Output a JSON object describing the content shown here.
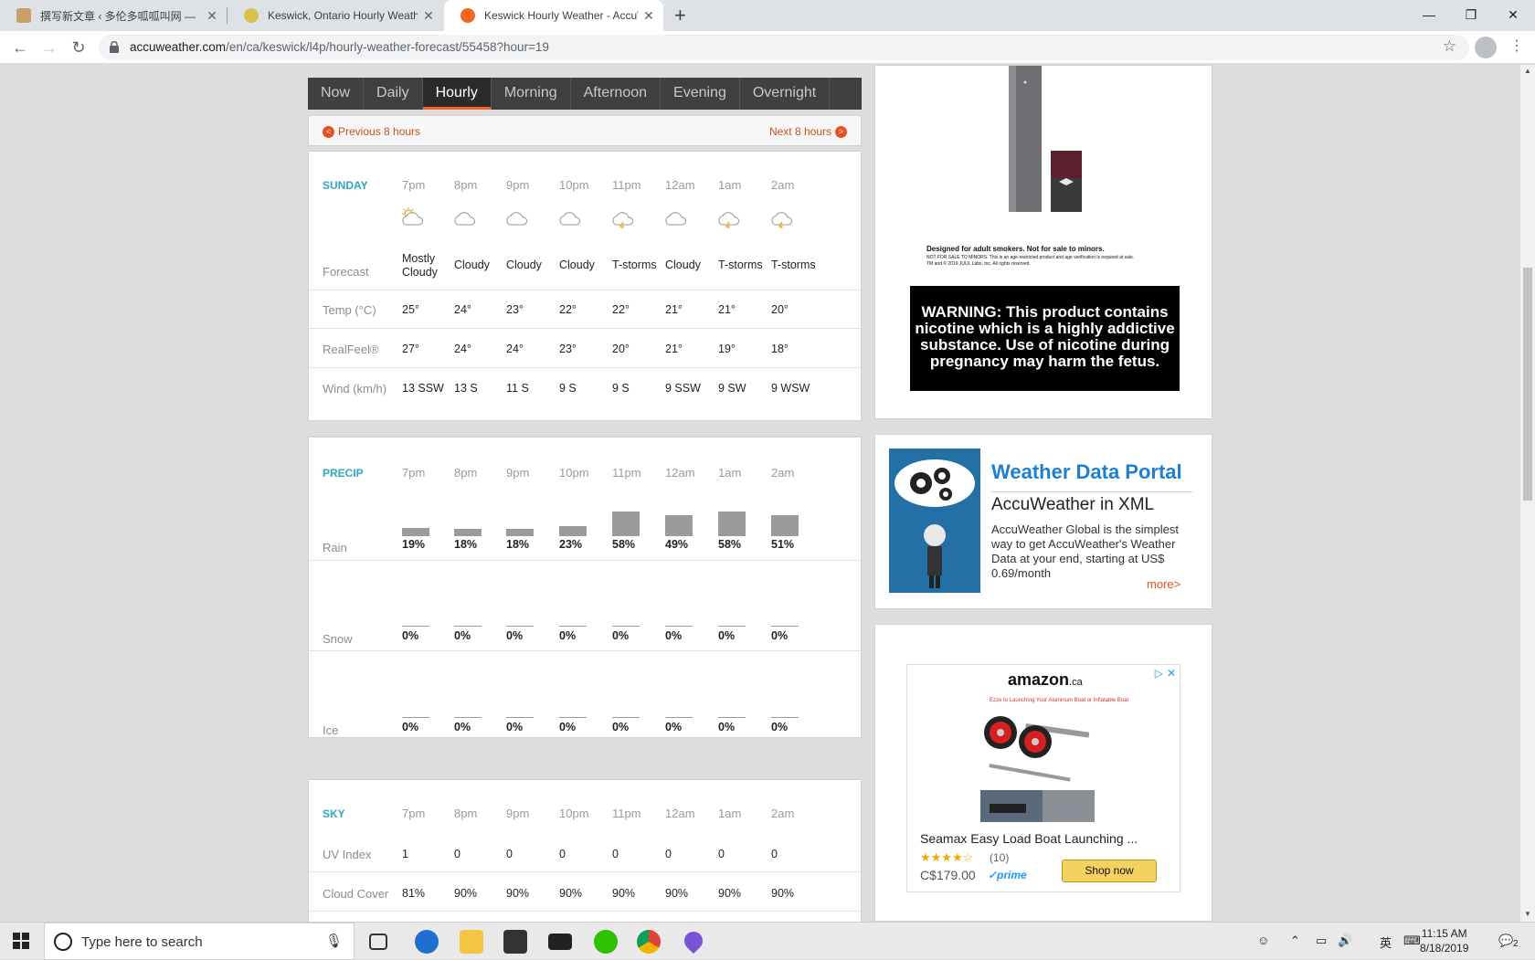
{
  "browser": {
    "tabs": [
      {
        "title": "撰写新文章 ‹ 多伦多呱呱叫网 —",
        "active": false
      },
      {
        "title": "Keswick, Ontario Hourly Weather",
        "active": false
      },
      {
        "title": "Keswick Hourly Weather - AccuW",
        "active": true
      }
    ],
    "url_host": "accuweather.com",
    "url_path": "/en/ca/keswick/l4p/hourly-weather-forecast/55458?hour=19"
  },
  "nav": {
    "tabs": [
      "Now",
      "Daily",
      "Hourly",
      "Morning",
      "Afternoon",
      "Evening",
      "Overnight"
    ],
    "active": "Hourly"
  },
  "pager": {
    "previous": "Previous 8 hours",
    "next": "Next 8 hours"
  },
  "hours": [
    "7pm",
    "8pm",
    "9pm",
    "10pm",
    "11pm",
    "12am",
    "1am",
    "2am"
  ],
  "forecast": {
    "day": "SUNDAY",
    "forecast_label": "Forecast",
    "icons": [
      "partly-sunny-icon",
      "cloud-icon",
      "cloud-icon",
      "cloud-icon",
      "thunderstorm-icon",
      "cloud-icon",
      "thunderstorm-icon",
      "thunderstorm-icon"
    ],
    "conditions": [
      "Mostly Cloudy",
      "Cloudy",
      "Cloudy",
      "Cloudy",
      "T-storms",
      "Cloudy",
      "T-storms",
      "T-storms"
    ],
    "temp_label": "Temp (°C)",
    "temp": [
      "25°",
      "24°",
      "23°",
      "22°",
      "22°",
      "21°",
      "21°",
      "20°"
    ],
    "realfeel_label": "RealFeel®",
    "realfeel": [
      "27°",
      "24°",
      "24°",
      "23°",
      "20°",
      "21°",
      "19°",
      "18°"
    ],
    "wind_label": "Wind (km/h)",
    "wind": [
      "13 SSW",
      "13 S",
      "11 S",
      "9 S",
      "9 S",
      "9 SSW",
      "9 SW",
      "9 WSW"
    ]
  },
  "precip": {
    "title": "PRECIP",
    "rain_label": "Rain",
    "rain": [
      "19%",
      "18%",
      "18%",
      "23%",
      "58%",
      "49%",
      "58%",
      "51%"
    ],
    "rain_values": [
      19,
      18,
      18,
      23,
      58,
      49,
      58,
      51
    ],
    "snow_label": "Snow",
    "snow": [
      "0%",
      "0%",
      "0%",
      "0%",
      "0%",
      "0%",
      "0%",
      "0%"
    ],
    "ice_label": "Ice",
    "ice": [
      "0%",
      "0%",
      "0%",
      "0%",
      "0%",
      "0%",
      "0%",
      "0%"
    ]
  },
  "sky": {
    "title": "SKY",
    "uv_label": "UV Index",
    "uv": [
      "1",
      "0",
      "0",
      "0",
      "0",
      "0",
      "0",
      "0"
    ],
    "cloud_label": "Cloud Cover",
    "cloud": [
      "81%",
      "90%",
      "90%",
      "90%",
      "90%",
      "90%",
      "90%",
      "90%"
    ]
  },
  "ads": {
    "juul_line1": "Designed for adult smokers. Not for sale to minors.",
    "juul_line2": "NOT FOR SALE TO MINORS. This is an age-restricted product and age verification is required at sale.",
    "juul_line3": "TM and © 2019 JUUL Labs, Inc. All rights reserved.",
    "warning": "WARNING: This product contains nicotine which is a highly addictive substance. Use of nicotine during pregnancy may harm the fetus.",
    "wdp_title": "Weather Data Portal",
    "wdp_sub": "AccuWeather in XML",
    "wdp_body": "AccuWeather Global is the simplest way to get AccuWeather's Weather Data at your end, starting at US$ 0.69/month",
    "wdp_more": "more>",
    "amazon_logo": "amazon",
    "amazon_tld": ".ca",
    "amazon_tagline": "Ezze to Launching Your Aluminum Boat or Inflatable Boat",
    "product": "Seamax Easy Load Boat Launching ...",
    "reviews": "(10)",
    "price": "C$179.00",
    "prime": "✓prime",
    "shop": "Shop now"
  },
  "taskbar": {
    "search_placeholder": "Type here to search",
    "time": "11:15 AM",
    "date": "8/18/2019",
    "ime": "英",
    "notifications": "2"
  }
}
